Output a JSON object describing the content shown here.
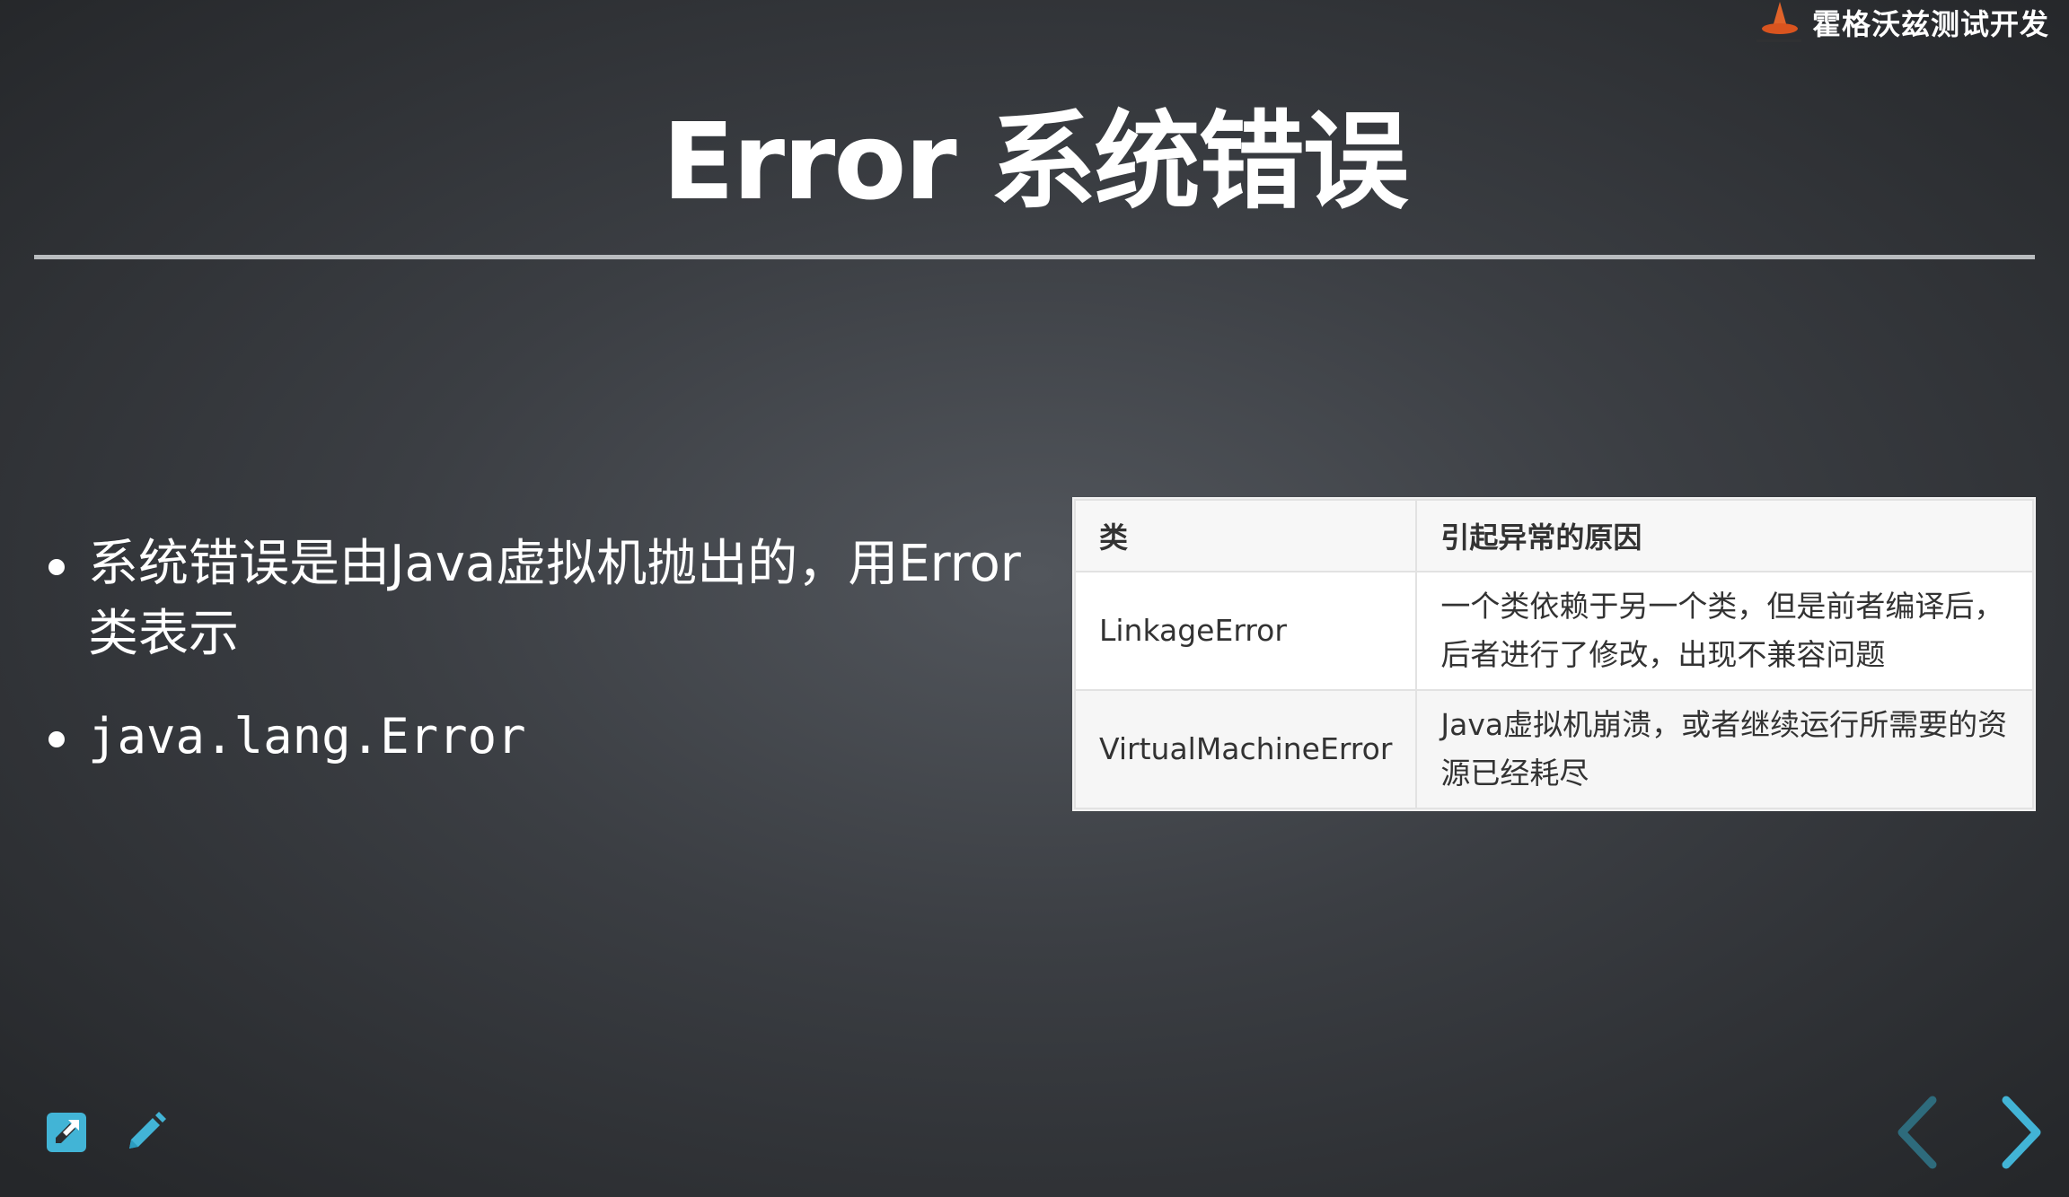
{
  "brand": {
    "name": "霍格沃兹测试开发"
  },
  "slide": {
    "title": "Error 系统错误",
    "bullets": [
      "系统错误是由Java虚拟机抛出的，用Error类表示",
      "java.lang.Error"
    ],
    "table": {
      "headers": [
        "类",
        "引起异常的原因"
      ],
      "rows": [
        [
          "LinkageError",
          "一个类依赖于另一个类，但是前者编译后，后者进行了修改，出现不兼容问题"
        ],
        [
          "VirtualMachineError",
          "Java虚拟机崩溃，或者继续运行所需要的资源已经耗尽"
        ]
      ]
    }
  },
  "toolbar": {
    "edit_icon": "external-edit-icon",
    "pen_icon": "pencil-icon"
  },
  "navigation": {
    "prev_icon": "chevron-left-icon",
    "next_icon": "chevron-right-icon"
  },
  "colors": {
    "accent": "#42b4d6",
    "background": "#3b3e43",
    "title_rule": "#b9bcbf"
  }
}
